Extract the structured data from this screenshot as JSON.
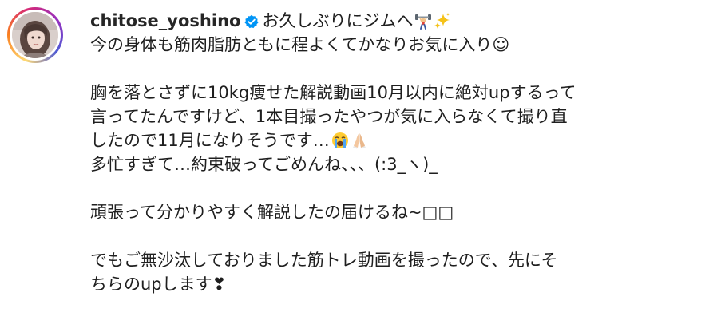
{
  "post": {
    "username": "chitose_yoshino",
    "caption_first": "お久しぶりにジムへ",
    "lines": [
      "今の身体も筋肉脂肪ともに程よくてかなりお気に入り☺",
      "胸を落とさずに10kg痩せた解説動画10月以内に絶対upするって",
      "言ってたんですけど、1本目撮ったやつが気に入らなくて撮り直",
      "したので11月になりそうです…",
      "多忙すぎて…約束破ってごめんね、、、(:3_ヽ)_",
      "頑張って分かりやすく解説したの届けるね~",
      "でもご無沙汰しておりました筋トレ動画を撮ったので、先にそ",
      "ちらのupします"
    ],
    "unrendered_glyphs": "□□",
    "heart": "❣",
    "icons": {
      "avatar": "profile-photo",
      "verified": "verified-badge-icon",
      "weightlift": "weight-lifter-emoji-icon",
      "sparkles": "sparkles-emoji-icon",
      "crying": "loudly-crying-face-emoji-icon",
      "pray": "folded-hands-emoji-icon"
    },
    "colors": {
      "verified_blue": "#0095f6",
      "text": "#1f1f1f"
    }
  }
}
